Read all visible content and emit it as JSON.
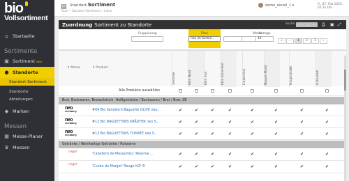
{
  "sidebar": {
    "logo_top": "bio",
    "logo_bottom": "Vollsortiment",
    "home": "Startseite",
    "section_sortiment": "Sortimente",
    "sortiment": "Sortiment",
    "sortiment_badge": "NEU",
    "standorte": "Standorte",
    "sub_standortsortiment": "Standort-Sortiment",
    "sub_standorte": "Standorte",
    "sub_abteilungen": "Abteilungen",
    "marken": "Marken",
    "section_messen": "Messen",
    "messe_planer": "Messe-Planer",
    "messen": "Messen"
  },
  "topbar": {
    "title_prefix": "Standort-",
    "title_main": "Sortiment",
    "breadcrumb": "Start › Standort-Sortiment › Index",
    "user": "demo_einzel_1 ▾",
    "datetime": "Fr, 07. Feb 2020, 02:31 Uhr"
  },
  "panel": {
    "heading_bold": "Zuordnung",
    "heading_rest": "Sortiment zu Standorte",
    "search_label": "Suche",
    "filters": [
      {
        "label": "Gruppierung",
        "value": "-"
      },
      {
        "label": "Filter",
        "value": "neu im Sortim..."
      },
      {
        "label": "",
        "value": "-"
      },
      {
        "label": "Marke",
        "value": "-"
      },
      {
        "label": "Anzeige",
        "value": "10"
      }
    ],
    "pager": [
      "«",
      "‹",
      "1",
      "2",
      "3",
      "›"
    ]
  },
  "table": {
    "col_marke": "Marke",
    "col_produkt": "Produkt",
    "stores": [
      "Zentrale",
      "Köln Nord",
      "Köln Süd",
      "Köln Ehrenfeld",
      "Lindenthal",
      "Nippes Markt",
      "Hauptstraße",
      "Gütersloh"
    ],
    "select_all": "Alle Produkte auswählen",
    "group1": "Brot, Backwaren, Brotaufstrich, Heißgetränke / Backwaren / Brot / Brot, SB",
    "products1": [
      {
        "brand": "neo bakery",
        "name": "#04 Bio Sandwich Baguette OLIVE neo..."
      },
      {
        "brand": "neo bakery",
        "name": "#12 Bio BAGUETTINIS KRÄUTER neo S..."
      },
      {
        "brand": "neo bakery",
        "name": "#13 Bio BAGUETTINIS TOMATE neo S..."
      }
    ],
    "group2": "Getränke / Weinhaltige Getränke / Rotweine",
    "products2": [
      {
        "brand": "riegel",
        "name": "'Caballero de Mesaumbu' Reserva ..."
      },
      {
        "brand": "riegel",
        "name": "'Cuvée du Margot' Rouge IGP ®"
      }
    ]
  }
}
